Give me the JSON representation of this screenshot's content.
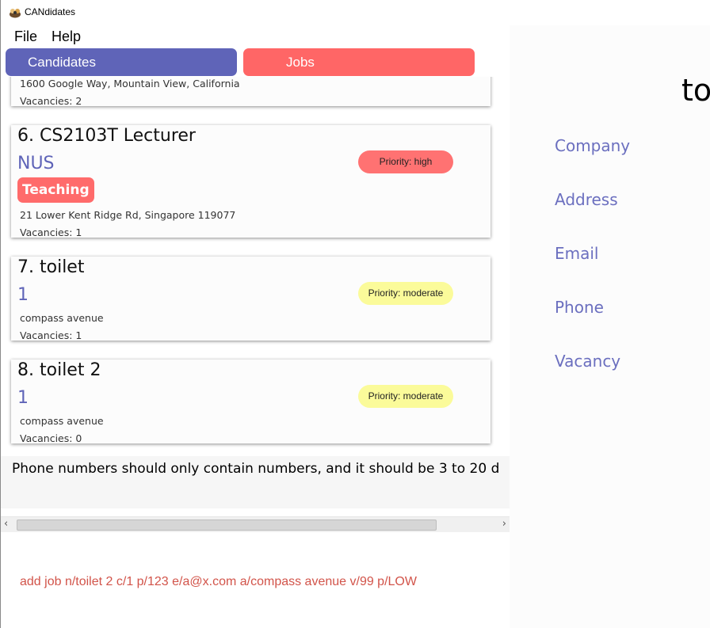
{
  "window": {
    "title": "CANdidates"
  },
  "menu": {
    "file": "File",
    "help": "Help"
  },
  "tabs": {
    "candidates": "Candidates",
    "jobs": "Jobs"
  },
  "colors": {
    "primary": "#5f64b8",
    "accent": "#ff6666",
    "priority_high": "#ff7272",
    "priority_moderate": "#fbfb9a",
    "command_text": "#d2544a"
  },
  "jobs": [
    {
      "address": "1600 Google Way, Mountain View, California",
      "vacancies": "Vacancies: 2"
    },
    {
      "index": "6.",
      "title": "CS2103T Lecturer",
      "company": "NUS",
      "tag": "Teaching",
      "address": "21 Lower Kent Ridge Rd, Singapore 119077",
      "vacancies": "Vacancies: 1",
      "priority": "Priority: high"
    },
    {
      "index": "7.",
      "title": "toilet",
      "company": "1",
      "address": "compass avenue",
      "vacancies": "Vacancies: 1",
      "priority": "Priority: moderate"
    },
    {
      "index": "8.",
      "title": "toilet 2",
      "company": "1",
      "address": "compass avenue",
      "vacancies": "Vacancies: 0",
      "priority": "Priority: moderate"
    }
  ],
  "result": {
    "message": "Phone numbers should only contain numbers, and it should be 3 to 20 d"
  },
  "command": {
    "text": "add job n/toilet 2 c/1 p/123 e/a@x.com a/compass avenue v/99 p/LOW"
  },
  "details": {
    "title": "to",
    "labels": {
      "company": "Company",
      "address": "Address",
      "email": "Email",
      "phone": "Phone",
      "vacancy": "Vacancy"
    }
  }
}
